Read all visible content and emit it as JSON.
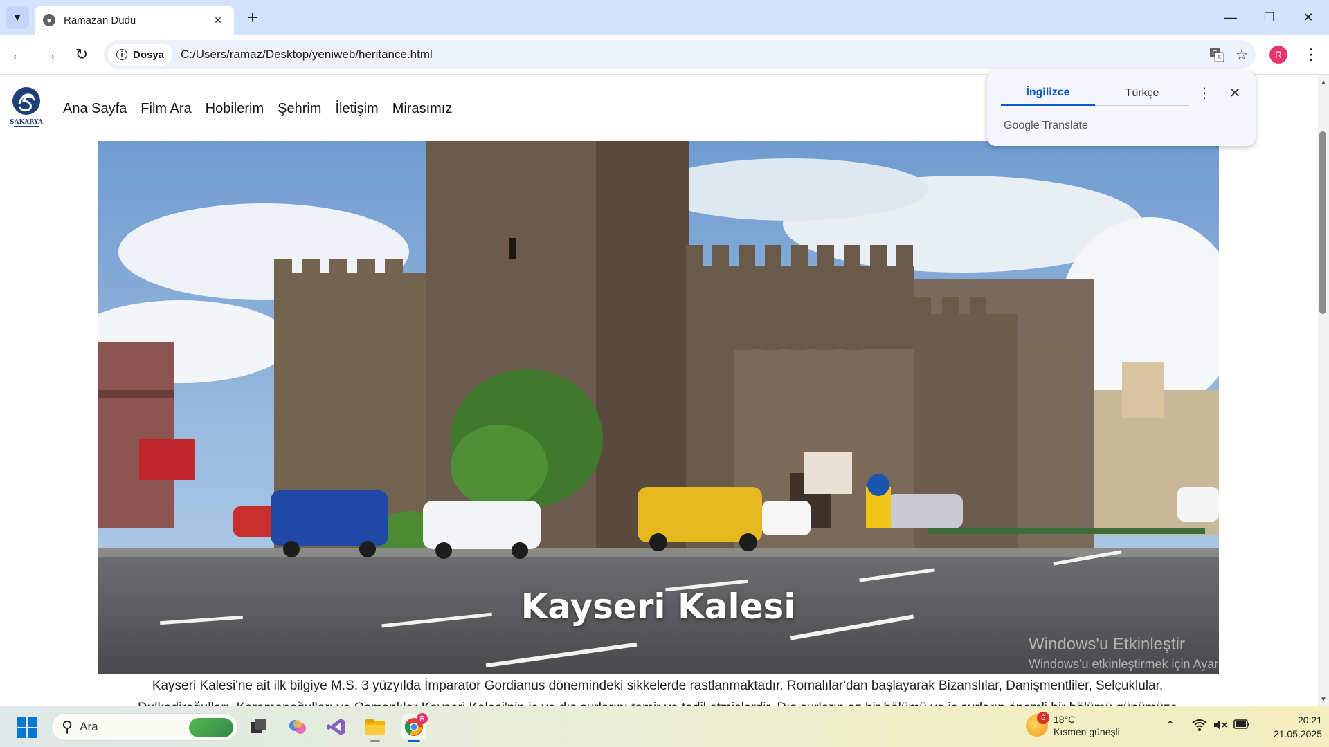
{
  "browser": {
    "tab_title": "Ramazan Dudu",
    "site_chip_label": "Dosya",
    "url": "C:/Users/ramaz/Desktop/yeniweb/heritance.html",
    "profile_initial": "R"
  },
  "site": {
    "logo_text": "SAKARYA",
    "nav": [
      "Ana Sayfa",
      "Film Ara",
      "Hobilerim",
      "Şehrim",
      "İletişim",
      "Mirasımız"
    ],
    "hero_title": "Kayseri Kalesi",
    "paragraph": "Kayseri Kalesi'ne ait ilk bilgiye M.S. 3 yüzyılda İmparator Gordianus dönemindeki sikkelerde rastlanmaktadır. Romalılar'dan başlayarak Bizanslılar, Danişmentliler, Selçuklular, Dulkadiroğulları, Karamanoğulları ve Osmanlılar Kayseri Kalesi'nin iç ve dış surlarını tamir ve tadil etmişlerdir. Dış surların az bir bölümü ve iç surların önemli bir bölümü günümüze"
  },
  "translate_popup": {
    "tab_active": "İngilizce",
    "tab_inactive": "Türkçe",
    "brand": "Google Translate"
  },
  "watermark": {
    "line1": "Windows'u Etkinleştir",
    "line2": "Windows'u etkinleştirmek için Ayarlar'a gidin."
  },
  "taskbar": {
    "search_label": "Ara",
    "weather_badge": "6",
    "weather_temp": "18°C",
    "weather_desc": "Kısmen güneşli",
    "time": "20:21",
    "date": "21.05.2025",
    "chrome_badge": "R"
  }
}
